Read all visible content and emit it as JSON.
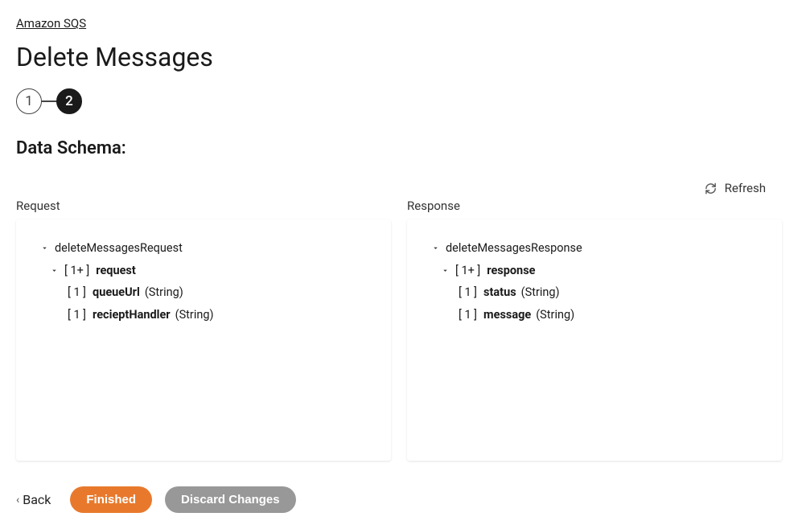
{
  "breadcrumb": {
    "label": "Amazon SQS"
  },
  "page_title": "Delete Messages",
  "stepper": {
    "steps": [
      "1",
      "2"
    ],
    "active_index": 1
  },
  "section_title": "Data Schema:",
  "refresh_label": "Refresh",
  "columns": {
    "request": {
      "label": "Request",
      "root": "deleteMessagesRequest",
      "group": {
        "cardinality": "[ 1+ ]",
        "name": "request"
      },
      "fields": [
        {
          "cardinality": "[ 1 ]",
          "name": "queueUrl",
          "type": "(String)"
        },
        {
          "cardinality": "[ 1 ]",
          "name": "recieptHandler",
          "type": "(String)"
        }
      ]
    },
    "response": {
      "label": "Response",
      "root": "deleteMessagesResponse",
      "group": {
        "cardinality": "[ 1+ ]",
        "name": "response"
      },
      "fields": [
        {
          "cardinality": "[ 1 ]",
          "name": "status",
          "type": "(String)"
        },
        {
          "cardinality": "[ 1 ]",
          "name": "message",
          "type": "(String)"
        }
      ]
    }
  },
  "buttons": {
    "back": "Back",
    "finished": "Finished",
    "discard": "Discard Changes"
  }
}
